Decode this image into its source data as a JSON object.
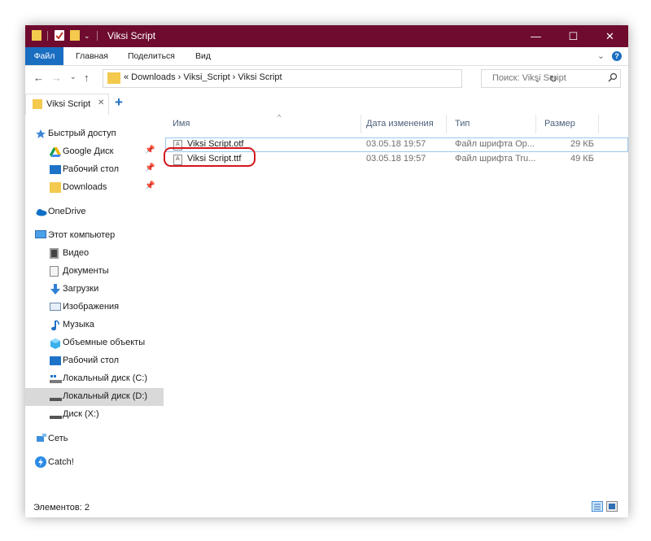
{
  "window": {
    "title": "Viksi Script",
    "minimize": "—",
    "maximize": "☐",
    "close": "✕"
  },
  "ribbon": {
    "tabs": [
      "Файл",
      "Главная",
      "Поделиться",
      "Вид"
    ],
    "collapse": "⌄",
    "help": "?"
  },
  "address": {
    "back": "←",
    "forward": "→",
    "recent": "⌄",
    "up": "↑",
    "path": "« Downloads › Viksi_Script › Viksi Script",
    "dropdown": "⌄",
    "refresh": "↻",
    "search_placeholder": "Поиск: Viksi Script"
  },
  "tab": {
    "label": "Viksi Script",
    "close": "✕",
    "add": "+"
  },
  "nav": [
    {
      "label": "Быстрый доступ",
      "icon": "star-icon",
      "pinned": false,
      "color": "#3b86d4"
    },
    {
      "label": "Google Диск",
      "icon": "google-drive-icon",
      "pinned": true
    },
    {
      "label": "Рабочий стол",
      "icon": "desktop-icon",
      "pinned": true
    },
    {
      "label": "Downloads",
      "icon": "folder-icon",
      "pinned": true
    },
    {
      "label": "OneDrive",
      "icon": "onedrive-icon",
      "pinned": false
    },
    {
      "label": "Этот компьютер",
      "icon": "computer-icon",
      "pinned": false
    },
    {
      "label": "Видео",
      "icon": "video-icon",
      "pinned": false
    },
    {
      "label": "Документы",
      "icon": "documents-icon",
      "pinned": false
    },
    {
      "label": "Загрузки",
      "icon": "downloads-icon",
      "pinned": false
    },
    {
      "label": "Изображения",
      "icon": "pictures-icon",
      "pinned": false
    },
    {
      "label": "Музыка",
      "icon": "music-icon",
      "pinned": false
    },
    {
      "label": "Объемные объекты",
      "icon": "3d-objects-icon",
      "pinned": false
    },
    {
      "label": "Рабочий стол",
      "icon": "desktop-icon",
      "pinned": false
    },
    {
      "label": "Локальный диск (C:)",
      "icon": "drive-c-icon",
      "pinned": false
    },
    {
      "label": "Локальный диск (D:)",
      "icon": "drive-icon",
      "pinned": false,
      "selected": true
    },
    {
      "label": "Диск (X:)",
      "icon": "drive-icon",
      "pinned": false
    },
    {
      "label": "Сеть",
      "icon": "network-icon",
      "pinned": false
    },
    {
      "label": "Catch!",
      "icon": "catch-icon",
      "pinned": false
    }
  ],
  "columns": {
    "name": "Имя",
    "date": "Дата изменения",
    "type": "Тип",
    "size": "Размер",
    "sort_indicator": "^"
  },
  "files": [
    {
      "name": "Viksi Script.otf",
      "date": "03.05.18 19:57",
      "type": "Файл шрифта Op...",
      "size": "29 КБ"
    },
    {
      "name": "Viksi Script.ttf",
      "date": "03.05.18 19:57",
      "type": "Файл шрифта Tru...",
      "size": "49 КБ"
    }
  ],
  "status": {
    "items": "Элементов: 2"
  },
  "colors": {
    "titlebar": "#6e0b2f",
    "file_tab": "#1a6ec1",
    "highlight": "#d3161d",
    "selected_nav": "#d9d9d9"
  }
}
